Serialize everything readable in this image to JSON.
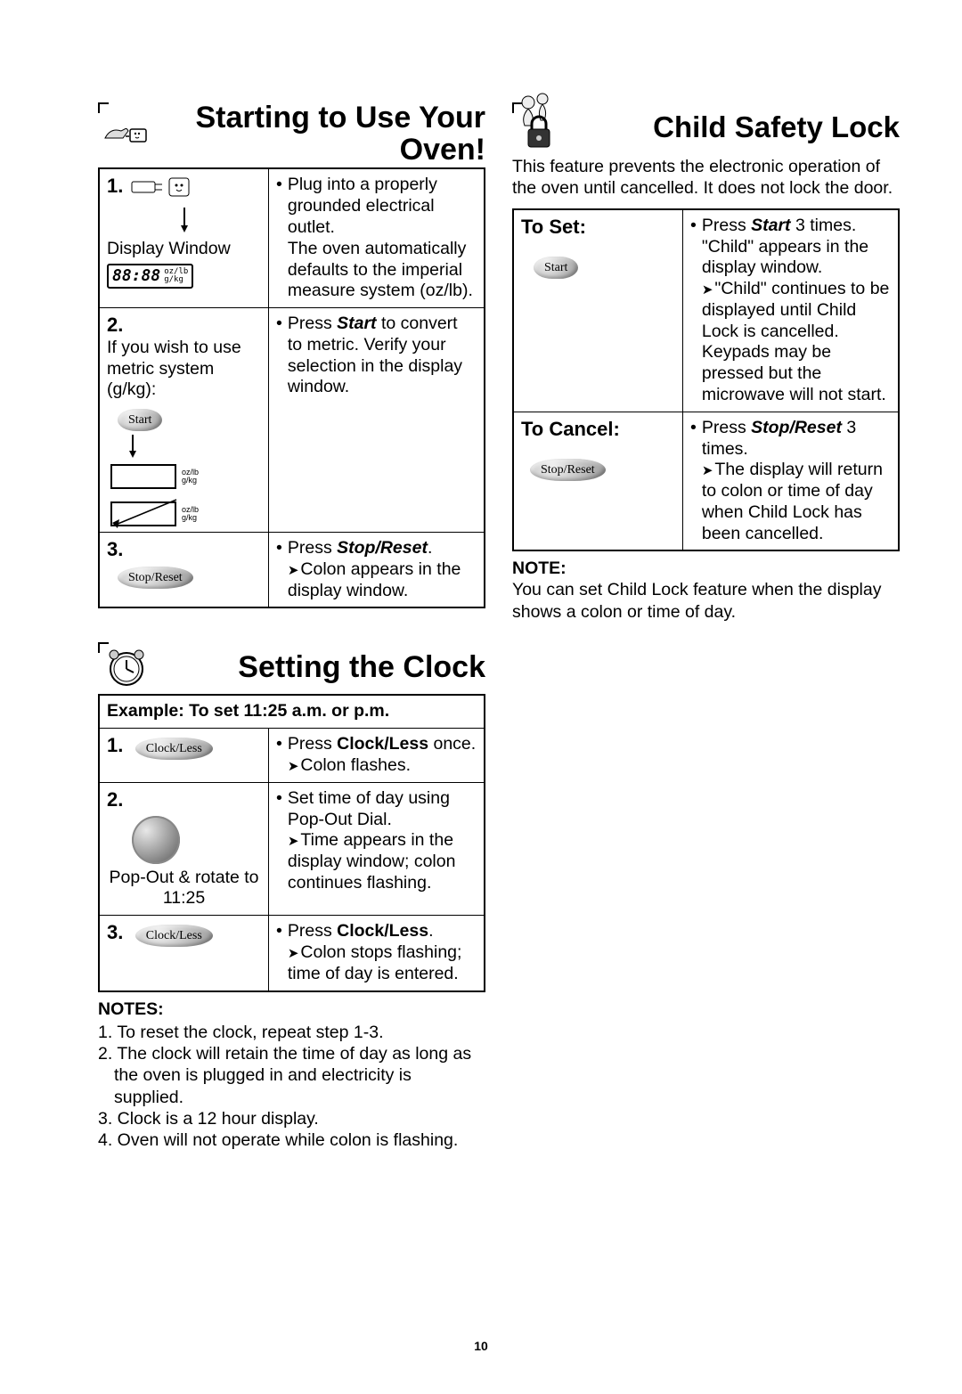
{
  "page_number": "10",
  "sections": {
    "starting": {
      "title": "Starting to Use Your Oven!",
      "steps": [
        {
          "num": "1.",
          "left_label": "Display Window",
          "display_text": "88:88",
          "units_top": "oz/lb",
          "units_bot": "g/kg",
          "right_text": "Plug into a properly grounded electrical outlet.\nThe oven automatically defaults to the imperial measure system (oz/lb)."
        },
        {
          "num": "2.",
          "left_text": "If you wish to use metric system (g/kg):",
          "button": "Start",
          "units_top": "oz/lb",
          "units_mid": "g/kg",
          "units_bot2": "oz/lb",
          "units_bot3": "g/kg",
          "right_pre": "Press ",
          "right_bold": "Start",
          "right_post": " to convert to metric. Verify your selection in the display window."
        },
        {
          "num": "3.",
          "button": "Stop/Reset",
          "right_pre": "Press ",
          "right_bold": "Stop/Reset",
          "right_post": ".",
          "arrow_text": "Colon appears in the display window."
        }
      ]
    },
    "clock": {
      "title": "Setting the Clock",
      "example": "Example: To set 11:25 a.m. or p.m.",
      "steps": [
        {
          "num": "1.",
          "button": "Clock/Less",
          "right_pre": "Press ",
          "right_bold": "Clock/Less",
          "right_post": " once.",
          "arrow_text": "Colon flashes."
        },
        {
          "num": "2.",
          "left_text": "Pop-Out & rotate to 11:25",
          "right_text": "Set time of day using Pop-Out Dial.",
          "arrow_text": "Time appears in the display window; colon continues flashing."
        },
        {
          "num": "3.",
          "button": "Clock/Less",
          "right_pre": "Press ",
          "right_bold": "Clock/Less",
          "right_post": ".",
          "arrow_text": "Colon stops flashing; time of day is entered."
        }
      ],
      "notes_label": "NOTES:",
      "notes": [
        "1. To reset the clock, repeat step 1-3.",
        "2. The clock will retain the time of day as long as the oven is plugged in and electricity is supplied.",
        "3. Clock is a 12 hour display.",
        "4. Oven will not operate while colon is flashing."
      ]
    },
    "lock": {
      "title": "Child Safety Lock",
      "intro": "This feature prevents the electronic operation of the oven until cancelled. It does not lock the door.",
      "rows": [
        {
          "label": "To Set:",
          "button": "Start",
          "right_pre": "Press ",
          "right_bold": "Start",
          "right_post": " 3 times. \"Child\" appears in the display window.",
          "arrow_text": "\"Child\" continues to be displayed until Child Lock is cancelled. Keypads may be pressed but the microwave will not start."
        },
        {
          "label": "To Cancel:",
          "button": "Stop/Reset",
          "right_pre": "Press ",
          "right_bold": "Stop/Reset",
          "right_post": " 3 times.",
          "arrow_text": "The display will return to colon or time of day when Child Lock has been cancelled."
        }
      ],
      "note_label": "NOTE:",
      "note_text": "You can set Child Lock feature when the display shows a colon or time of day."
    }
  }
}
